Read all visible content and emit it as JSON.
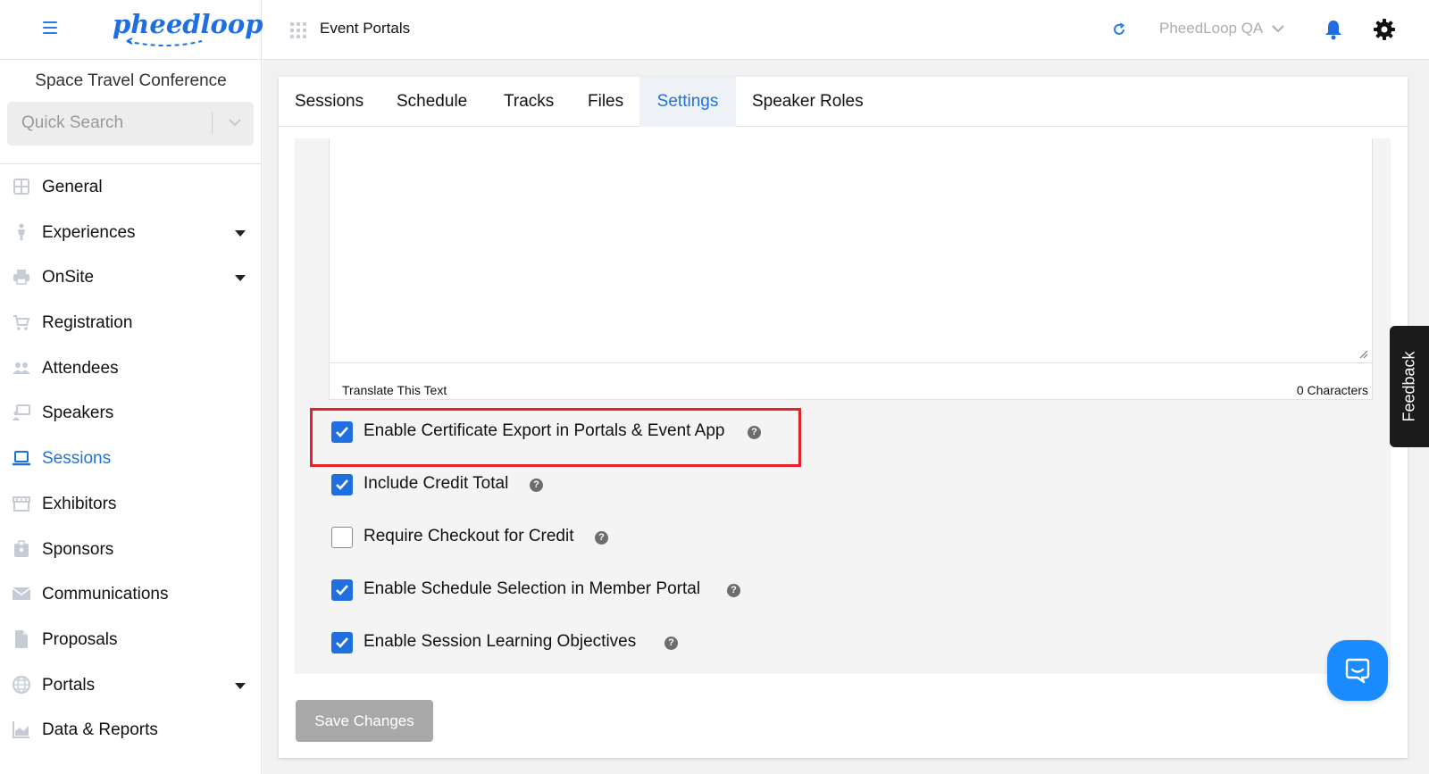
{
  "header": {
    "logo_text": "pheedloop",
    "module_title": "Event Portals",
    "org_name": "PheedLoop QA",
    "icons": [
      "hamburger-icon",
      "apps-grid-icon",
      "refresh-icon",
      "chevron-down-icon",
      "bell-icon",
      "gear-icon"
    ],
    "accent_color": "#1f6fe0"
  },
  "sidebar": {
    "event_name": "Space Travel Conference",
    "search_placeholder": "Quick Search",
    "items": [
      {
        "label": "General",
        "icon": "grid-icon",
        "expandable": false,
        "active": false
      },
      {
        "label": "Experiences",
        "icon": "person-icon",
        "expandable": true,
        "active": false
      },
      {
        "label": "OnSite",
        "icon": "printer-icon",
        "expandable": true,
        "active": false
      },
      {
        "label": "Registration",
        "icon": "cart-icon",
        "expandable": false,
        "active": false
      },
      {
        "label": "Attendees",
        "icon": "people-icon",
        "expandable": false,
        "active": false
      },
      {
        "label": "Speakers",
        "icon": "presenter-icon",
        "expandable": false,
        "active": false
      },
      {
        "label": "Sessions",
        "icon": "laptop-icon",
        "expandable": false,
        "active": true
      },
      {
        "label": "Exhibitors",
        "icon": "storefront-icon",
        "expandable": false,
        "active": false
      },
      {
        "label": "Sponsors",
        "icon": "badge-icon",
        "expandable": false,
        "active": false
      },
      {
        "label": "Communications",
        "icon": "mail-icon",
        "expandable": false,
        "active": false
      },
      {
        "label": "Proposals",
        "icon": "document-icon",
        "expandable": false,
        "active": false
      },
      {
        "label": "Portals",
        "icon": "globe-icon",
        "expandable": true,
        "active": false
      },
      {
        "label": "Data & Reports",
        "icon": "chart-icon",
        "expandable": false,
        "active": false
      }
    ]
  },
  "tabs": [
    {
      "label": "Sessions",
      "active": false
    },
    {
      "label": "Schedule",
      "active": false
    },
    {
      "label": "Tracks",
      "active": false
    },
    {
      "label": "Files",
      "active": false
    },
    {
      "label": "Settings",
      "active": true
    },
    {
      "label": "Speaker Roles",
      "active": false
    }
  ],
  "editor": {
    "translate_link": "Translate This Text",
    "char_count": "0 Characters"
  },
  "options": [
    {
      "label": "Enable Certificate Export in Portals & Event App",
      "checked": true,
      "highlighted": true
    },
    {
      "label": "Include Credit Total",
      "checked": true,
      "highlighted": false
    },
    {
      "label": "Require Checkout for Credit",
      "checked": false,
      "highlighted": false
    },
    {
      "label": "Enable Schedule Selection in Member Portal",
      "checked": true,
      "highlighted": false
    },
    {
      "label": "Enable Session Learning Objectives",
      "checked": true,
      "highlighted": false
    }
  ],
  "help_glyph": "?",
  "save_button": "Save Changes",
  "feedback_label": "Feedback",
  "chat_icon": "chat-bubble-icon",
  "colors": {
    "active_blue": "#1f73d8",
    "checkbox_blue": "#1f6fe0",
    "highlight_red": "#e8202a",
    "save_disabled_gray": "#a8a8a8",
    "chat_blue": "#1a8cff"
  }
}
